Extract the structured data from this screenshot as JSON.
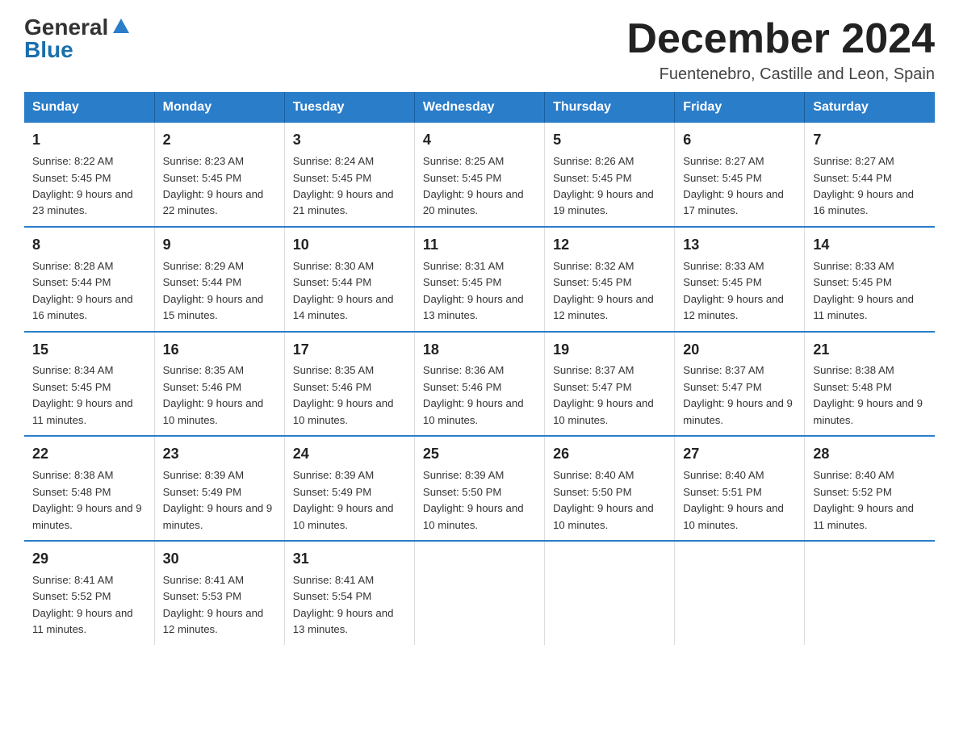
{
  "logo": {
    "general": "General",
    "blue": "Blue"
  },
  "title": "December 2024",
  "location": "Fuentenebro, Castille and Leon, Spain",
  "days_of_week": [
    "Sunday",
    "Monday",
    "Tuesday",
    "Wednesday",
    "Thursday",
    "Friday",
    "Saturday"
  ],
  "weeks": [
    [
      {
        "day": "1",
        "sunrise": "8:22 AM",
        "sunset": "5:45 PM",
        "daylight": "9 hours and 23 minutes."
      },
      {
        "day": "2",
        "sunrise": "8:23 AM",
        "sunset": "5:45 PM",
        "daylight": "9 hours and 22 minutes."
      },
      {
        "day": "3",
        "sunrise": "8:24 AM",
        "sunset": "5:45 PM",
        "daylight": "9 hours and 21 minutes."
      },
      {
        "day": "4",
        "sunrise": "8:25 AM",
        "sunset": "5:45 PM",
        "daylight": "9 hours and 20 minutes."
      },
      {
        "day": "5",
        "sunrise": "8:26 AM",
        "sunset": "5:45 PM",
        "daylight": "9 hours and 19 minutes."
      },
      {
        "day": "6",
        "sunrise": "8:27 AM",
        "sunset": "5:45 PM",
        "daylight": "9 hours and 17 minutes."
      },
      {
        "day": "7",
        "sunrise": "8:27 AM",
        "sunset": "5:44 PM",
        "daylight": "9 hours and 16 minutes."
      }
    ],
    [
      {
        "day": "8",
        "sunrise": "8:28 AM",
        "sunset": "5:44 PM",
        "daylight": "9 hours and 16 minutes."
      },
      {
        "day": "9",
        "sunrise": "8:29 AM",
        "sunset": "5:44 PM",
        "daylight": "9 hours and 15 minutes."
      },
      {
        "day": "10",
        "sunrise": "8:30 AM",
        "sunset": "5:44 PM",
        "daylight": "9 hours and 14 minutes."
      },
      {
        "day": "11",
        "sunrise": "8:31 AM",
        "sunset": "5:45 PM",
        "daylight": "9 hours and 13 minutes."
      },
      {
        "day": "12",
        "sunrise": "8:32 AM",
        "sunset": "5:45 PM",
        "daylight": "9 hours and 12 minutes."
      },
      {
        "day": "13",
        "sunrise": "8:33 AM",
        "sunset": "5:45 PM",
        "daylight": "9 hours and 12 minutes."
      },
      {
        "day": "14",
        "sunrise": "8:33 AM",
        "sunset": "5:45 PM",
        "daylight": "9 hours and 11 minutes."
      }
    ],
    [
      {
        "day": "15",
        "sunrise": "8:34 AM",
        "sunset": "5:45 PM",
        "daylight": "9 hours and 11 minutes."
      },
      {
        "day": "16",
        "sunrise": "8:35 AM",
        "sunset": "5:46 PM",
        "daylight": "9 hours and 10 minutes."
      },
      {
        "day": "17",
        "sunrise": "8:35 AM",
        "sunset": "5:46 PM",
        "daylight": "9 hours and 10 minutes."
      },
      {
        "day": "18",
        "sunrise": "8:36 AM",
        "sunset": "5:46 PM",
        "daylight": "9 hours and 10 minutes."
      },
      {
        "day": "19",
        "sunrise": "8:37 AM",
        "sunset": "5:47 PM",
        "daylight": "9 hours and 10 minutes."
      },
      {
        "day": "20",
        "sunrise": "8:37 AM",
        "sunset": "5:47 PM",
        "daylight": "9 hours and 9 minutes."
      },
      {
        "day": "21",
        "sunrise": "8:38 AM",
        "sunset": "5:48 PM",
        "daylight": "9 hours and 9 minutes."
      }
    ],
    [
      {
        "day": "22",
        "sunrise": "8:38 AM",
        "sunset": "5:48 PM",
        "daylight": "9 hours and 9 minutes."
      },
      {
        "day": "23",
        "sunrise": "8:39 AM",
        "sunset": "5:49 PM",
        "daylight": "9 hours and 9 minutes."
      },
      {
        "day": "24",
        "sunrise": "8:39 AM",
        "sunset": "5:49 PM",
        "daylight": "9 hours and 10 minutes."
      },
      {
        "day": "25",
        "sunrise": "8:39 AM",
        "sunset": "5:50 PM",
        "daylight": "9 hours and 10 minutes."
      },
      {
        "day": "26",
        "sunrise": "8:40 AM",
        "sunset": "5:50 PM",
        "daylight": "9 hours and 10 minutes."
      },
      {
        "day": "27",
        "sunrise": "8:40 AM",
        "sunset": "5:51 PM",
        "daylight": "9 hours and 10 minutes."
      },
      {
        "day": "28",
        "sunrise": "8:40 AM",
        "sunset": "5:52 PM",
        "daylight": "9 hours and 11 minutes."
      }
    ],
    [
      {
        "day": "29",
        "sunrise": "8:41 AM",
        "sunset": "5:52 PM",
        "daylight": "9 hours and 11 minutes."
      },
      {
        "day": "30",
        "sunrise": "8:41 AM",
        "sunset": "5:53 PM",
        "daylight": "9 hours and 12 minutes."
      },
      {
        "day": "31",
        "sunrise": "8:41 AM",
        "sunset": "5:54 PM",
        "daylight": "9 hours and 13 minutes."
      },
      null,
      null,
      null,
      null
    ]
  ]
}
